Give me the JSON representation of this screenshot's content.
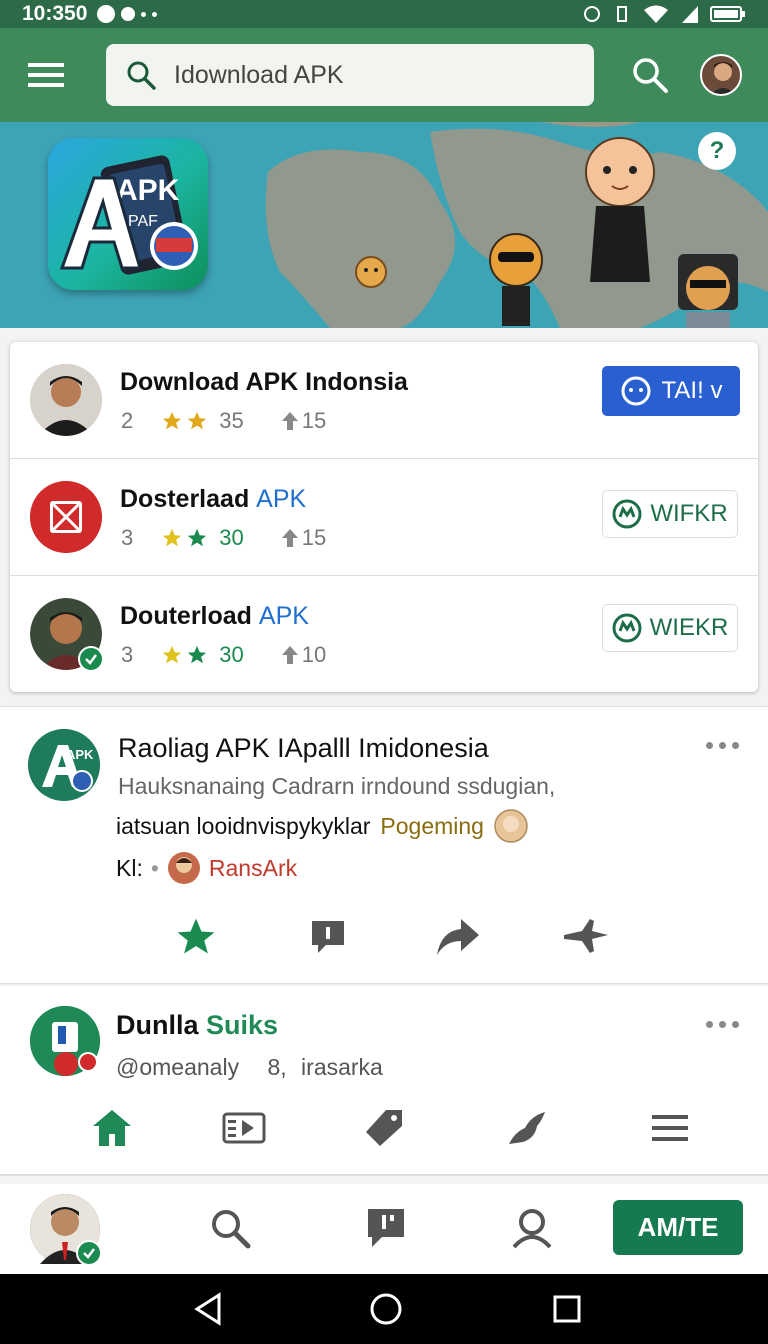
{
  "status": {
    "time": "10:350"
  },
  "appbar": {
    "search_value": "Idownload APK"
  },
  "banner": {
    "logo_text_main": "APK",
    "logo_text_sub": "PAF",
    "help_label": "?"
  },
  "list": [
    {
      "title_main": "Download APK Indonsia",
      "title_highlight": "",
      "num": "2",
      "rating": "35",
      "updates": "15",
      "button": "TAI! v",
      "button_style": "primary"
    },
    {
      "title_main": "Dosterlaad",
      "title_highlight": "APK",
      "num": "3",
      "rating": "30",
      "updates": "15",
      "button": "WIFKR",
      "button_style": "outline"
    },
    {
      "title_main": "Douterload",
      "title_highlight": "APK",
      "num": "3",
      "rating": "30",
      "updates": "10",
      "button": "WIEKR",
      "button_style": "outline"
    }
  ],
  "post": {
    "title": "Raoliag APK IApalll Imidonesia",
    "subtitle": "Hauksnanaing Cadrarn irndound ssdugian,",
    "desc": "iatsuan looidnvispykyklar",
    "tag": "Pogeming",
    "author_prefix": "Kl:",
    "author_name": "RansArk"
  },
  "post2": {
    "title_main": "Dunlla",
    "title_highlight": "Suiks",
    "handle": "@omeanaly",
    "stat_num": "8,",
    "stat_label": "irasarka"
  },
  "bottom": {
    "cta": "AM/TE"
  },
  "colors": {
    "brand_green": "#3f8a5a",
    "status_green": "#2d6b48",
    "primary_blue": "#2a5fd1",
    "cta_green": "#157a4f",
    "star_gold": "#e0a81c",
    "star_green": "#1b8a4f"
  }
}
